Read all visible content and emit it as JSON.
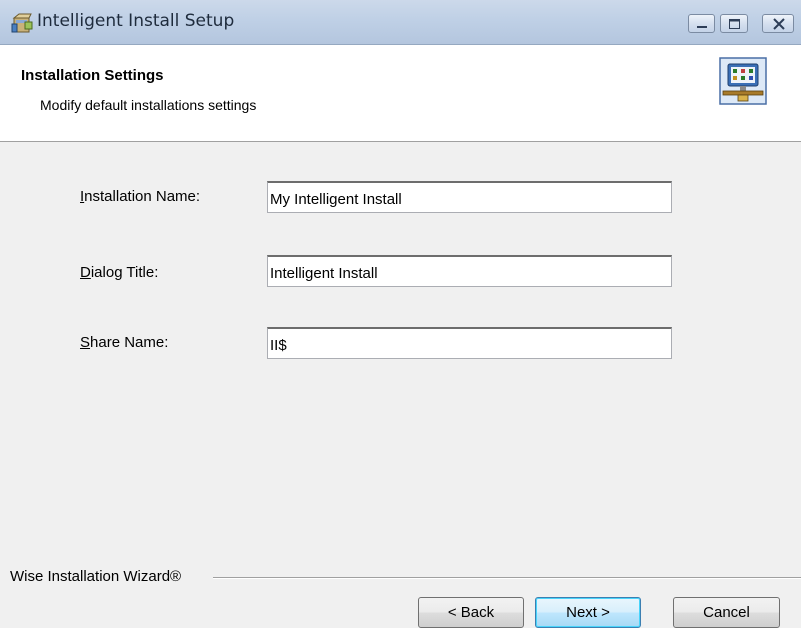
{
  "window": {
    "title": "Intelligent Install Setup"
  },
  "header": {
    "title": "Installation Settings",
    "subtitle": "Modify default installations settings",
    "icon": "network-computer-icon"
  },
  "form": {
    "fields": [
      {
        "label": "Installation Name:",
        "value": "My Intelligent Install",
        "access_key": "I"
      },
      {
        "label": "Dialog Title:",
        "value": "Intelligent Install",
        "access_key": "D"
      },
      {
        "label": "Share Name:",
        "value": "II$",
        "access_key": "S"
      }
    ]
  },
  "footer": {
    "brand": "Wise Installation Wizard®",
    "back_label": "< Back",
    "next_label": "Next >",
    "cancel_label": "Cancel"
  },
  "colors": {
    "titlebar": "#bfd0e6",
    "default_button_border": "#3c7fb1"
  }
}
